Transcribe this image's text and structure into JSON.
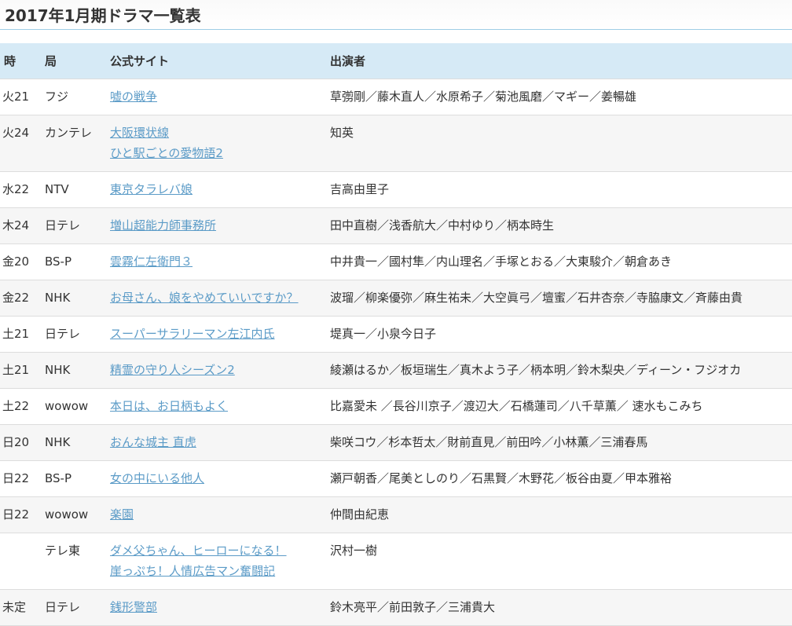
{
  "title": "2017年1月期ドラマ一覧表",
  "headers": {
    "time": "時",
    "channel": "局",
    "site": "公式サイト",
    "cast": "出演者"
  },
  "rows": [
    {
      "time": "火21",
      "channel": "フジ",
      "site": [
        "嘘の戦争"
      ],
      "cast": "草彅剛／藤木直人／水原希子／菊池風磨／マギー／姜暢雄"
    },
    {
      "time": "火24",
      "channel": "カンテレ",
      "site": [
        "大阪環状線",
        "ひと駅ごとの愛物語2"
      ],
      "cast": "知英"
    },
    {
      "time": "水22",
      "channel": "NTV",
      "site": [
        "東京タラレバ娘"
      ],
      "cast": "吉高由里子"
    },
    {
      "time": "木24",
      "channel": "日テレ",
      "site": [
        "増山超能力師事務所"
      ],
      "cast": "田中直樹／浅香航大／中村ゆり／柄本時生"
    },
    {
      "time": "金20",
      "channel": "BS-P",
      "site": [
        "雲霧仁左衛門３"
      ],
      "cast": "中井貴一／國村隼／内山理名／手塚とおる／大東駿介／朝倉あき"
    },
    {
      "time": "金22",
      "channel": "NHK",
      "site": [
        "お母さん、娘をやめていいですか？"
      ],
      "cast": "波瑠／柳楽優弥／麻生祐未／大空眞弓／壇蜜／石井杏奈／寺脇康文／斉藤由貴"
    },
    {
      "time": "土21",
      "channel": "日テレ",
      "site": [
        "スーパーサラリーマン左江内氏"
      ],
      "cast": "堤真一／小泉今日子"
    },
    {
      "time": "土21",
      "channel": "NHK",
      "site": [
        "精霊の守り人シーズン2"
      ],
      "cast": "綾瀬はるか／板垣瑞生／真木よう子／柄本明／鈴木梨央／ディーン・フジオカ"
    },
    {
      "time": "土22",
      "channel": "wowow",
      "site": [
        "本日は、お日柄もよく"
      ],
      "cast": "比嘉愛未 ／長谷川京子／渡辺大／石橋蓮司／八千草薫／ 速水もこみち"
    },
    {
      "time": "日20",
      "channel": "NHK",
      "site": [
        "おんな城主 直虎"
      ],
      "cast": "柴咲コウ／杉本哲太／財前直見／前田吟／小林薫／三浦春馬"
    },
    {
      "time": "日22",
      "channel": "BS-P",
      "site": [
        "女の中にいる他人"
      ],
      "cast": "瀬戸朝香／尾美としのり／石黒賢／木野花／板谷由夏／甲本雅裕"
    },
    {
      "time": "日22",
      "channel": "wowow",
      "site": [
        "楽園"
      ],
      "cast": "仲間由紀恵"
    },
    {
      "time": "",
      "channel": "テレ東",
      "site": [
        "ダメ父ちゃん、ヒーローになる！",
        "崖っぷち！人情広告マン奮闘記"
      ],
      "cast": "沢村一樹"
    },
    {
      "time": "未定",
      "channel": "日テレ",
      "site": [
        "銭形警部"
      ],
      "cast": "鈴木亮平／前田敦子／三浦貴大"
    }
  ]
}
